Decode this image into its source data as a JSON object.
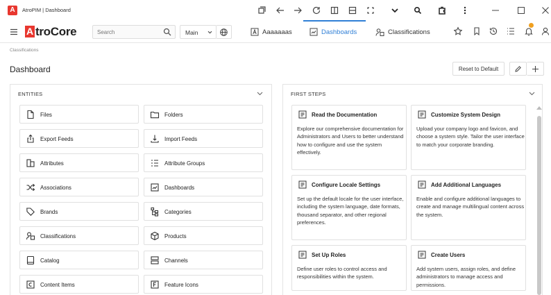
{
  "window": {
    "title": "AtroPIM | Dashboard"
  },
  "header": {
    "brand_letter": "A",
    "brand_rest": "troCore",
    "search_placeholder": "Search",
    "main_select": "Main",
    "nav": [
      {
        "label": "Aaaaaaas",
        "icon": "a-box-icon"
      },
      {
        "label": "Dashboards",
        "icon": "dashboard-icon",
        "active": true
      },
      {
        "label": "Classifications",
        "icon": "classification-icon"
      }
    ],
    "accent_color": "#2f7fd6",
    "brand_color": "#e8372f",
    "notification_color": "#f0a020"
  },
  "breadcrumb": "Classifications",
  "page_title": "Dashboard",
  "buttons": {
    "reset": "Reset to Default"
  },
  "entities": {
    "title": "ENTITIES",
    "items": [
      {
        "label": "Files",
        "icon": "file-icon"
      },
      {
        "label": "Folders",
        "icon": "folder-icon"
      },
      {
        "label": "Export Feeds",
        "icon": "export-icon"
      },
      {
        "label": "Import Feeds",
        "icon": "import-icon"
      },
      {
        "label": "Attributes",
        "icon": "attributes-icon"
      },
      {
        "label": "Attribute Groups",
        "icon": "attribute-groups-icon"
      },
      {
        "label": "Associations",
        "icon": "shuffle-icon"
      },
      {
        "label": "Dashboards",
        "icon": "dashboard-icon"
      },
      {
        "label": "Brands",
        "icon": "tag-icon"
      },
      {
        "label": "Categories",
        "icon": "categories-icon"
      },
      {
        "label": "Classifications",
        "icon": "classification-icon"
      },
      {
        "label": "Products",
        "icon": "package-icon"
      },
      {
        "label": "Catalog",
        "icon": "catalog-icon"
      },
      {
        "label": "Channels",
        "icon": "channels-icon"
      },
      {
        "label": "Content Items",
        "icon": "content-icon"
      },
      {
        "label": "Feature Icons",
        "icon": "feature-icon"
      }
    ]
  },
  "first_steps": {
    "title": "FIRST STEPS",
    "cards": [
      {
        "title": "Read the Documentation",
        "body": "Explore our comprehensive documentation for Administrators and Users to better understand how to configure and use the system effectively."
      },
      {
        "title": "Customize System Design",
        "body": "Upload your company logo and favicon, and choose a system style. Tailor the user interface to match your corporate branding."
      },
      {
        "title": "Configure Locale Settings",
        "body": "Set up the default locale for the user interface, including the system language, date formats, thousand separator, and other regional preferences."
      },
      {
        "title": "Add Additional Languages",
        "body": "Enable and configure additional languages to create and manage multilingual content across the system."
      },
      {
        "title": "Set Up Roles",
        "body": "Define user roles to control access and responsibilities within the system."
      },
      {
        "title": "Create Users",
        "body": "Add system users, assign roles, and define administrators to manage access and permissions."
      }
    ]
  }
}
